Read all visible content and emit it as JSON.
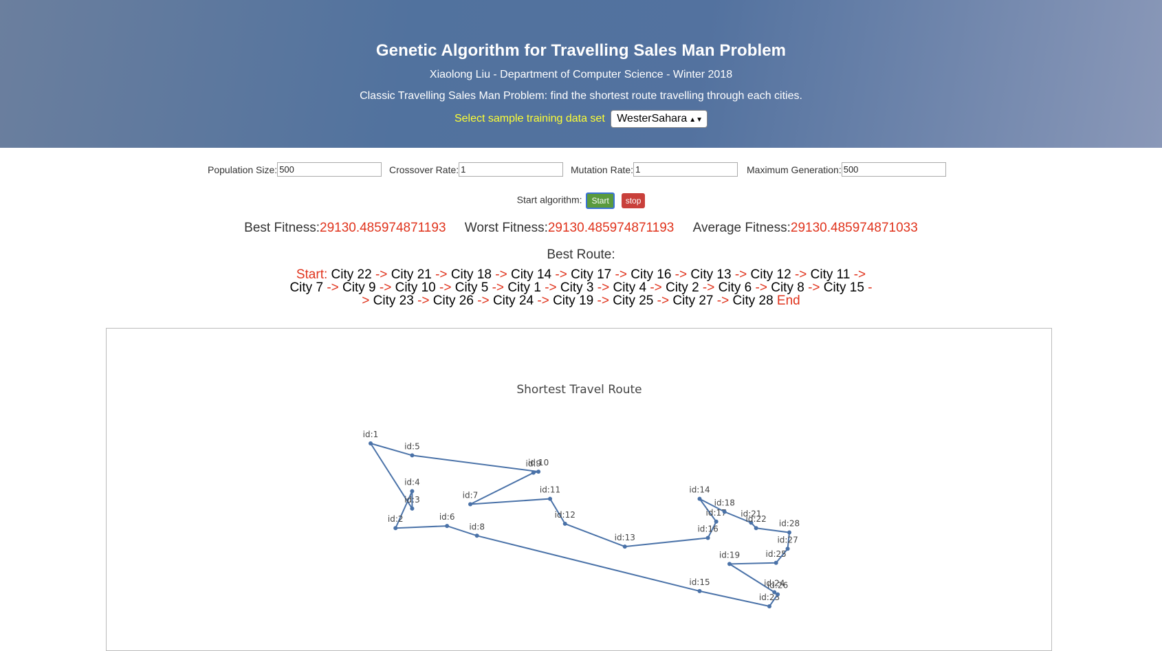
{
  "header": {
    "title": "Genetic Algorithm for Travelling Sales Man Problem",
    "author": "Xiaolong Liu - Department of Computer Science - Winter 2018",
    "description": "Classic Travelling Sales Man Problem: find the shortest route travelling through each cities.",
    "dataset_label": "Select sample training data set",
    "dataset_selected": "WesterSahara"
  },
  "params": {
    "population_label": "Population Size:",
    "population_value": "500",
    "crossover_label": "Crossover Rate:",
    "crossover_value": "1",
    "mutation_label": "Mutation Rate:",
    "mutation_value": "1",
    "maxgen_label": "Maximum Generation:",
    "maxgen_value": "500"
  },
  "controls": {
    "start_label": "Start algorithm:",
    "start_button": "Start",
    "stop_button": "stop"
  },
  "fitness": {
    "best_label": "Best Fitness:",
    "best_value": "29130.485974871193",
    "worst_label": "Worst Fitness:",
    "worst_value": "29130.485974871193",
    "average_label": "Average Fitness:",
    "average_value": "29130.485974871033"
  },
  "route": {
    "title": "Best Route:",
    "start": "Start:",
    "end": "End",
    "arrow": "->",
    "lines": [
      [
        "City 22",
        "City 21",
        "City 18",
        "City 14",
        "City 17",
        "City 16",
        "City 13",
        "City 12",
        "City 11"
      ],
      [
        "City 7",
        "City 9",
        "City 10",
        "City 5",
        "City 1",
        "City 3",
        "City 4",
        "City 2",
        "City 6",
        "City 8",
        "City 15"
      ],
      [
        "City 23",
        "City 26",
        "City 24",
        "City 19",
        "City 25",
        "City 27",
        "City 28"
      ]
    ]
  },
  "chart_data": {
    "type": "line",
    "title": "Shortest Travel Route",
    "line_color": "#4a72a8",
    "points": [
      {
        "id": "id:1",
        "x": 0.5,
        "y": 9.5
      },
      {
        "id": "id:2",
        "x": 2.0,
        "y": 1.7
      },
      {
        "id": "id:3",
        "x": 3.0,
        "y": 3.5
      },
      {
        "id": "id:4",
        "x": 3.0,
        "y": 5.1
      },
      {
        "id": "id:5",
        "x": 3.0,
        "y": 8.4
      },
      {
        "id": "id:6",
        "x": 5.1,
        "y": 1.9
      },
      {
        "id": "id:7",
        "x": 6.5,
        "y": 3.9
      },
      {
        "id": "id:8",
        "x": 6.9,
        "y": 1.0
      },
      {
        "id": "id:9",
        "x": 10.3,
        "y": 6.8
      },
      {
        "id": "id:10",
        "x": 10.6,
        "y": 6.9
      },
      {
        "id": "id:11",
        "x": 11.3,
        "y": 4.4
      },
      {
        "id": "id:12",
        "x": 12.2,
        "y": 2.1
      },
      {
        "id": "id:13",
        "x": 15.8,
        "y": 0.0
      },
      {
        "id": "id:14",
        "x": 20.3,
        "y": 4.4
      },
      {
        "id": "id:15",
        "x": 20.3,
        "y": -4.1
      },
      {
        "id": "id:16",
        "x": 20.8,
        "y": 0.8
      },
      {
        "id": "id:17",
        "x": 21.3,
        "y": 2.3
      },
      {
        "id": "id:18",
        "x": 21.8,
        "y": 3.2
      },
      {
        "id": "id:19",
        "x": 22.1,
        "y": -1.6
      },
      {
        "id": "id:21",
        "x": 23.4,
        "y": 2.2
      },
      {
        "id": "id:22",
        "x": 23.7,
        "y": 1.7
      },
      {
        "id": "id:23",
        "x": 24.5,
        "y": -5.5
      },
      {
        "id": "id:24",
        "x": 24.8,
        "y": -4.2
      },
      {
        "id": "id:25",
        "x": 24.9,
        "y": -1.5
      },
      {
        "id": "id:26",
        "x": 25.0,
        "y": -4.4
      },
      {
        "id": "id:27",
        "x": 25.6,
        "y": -0.2
      },
      {
        "id": "id:28",
        "x": 25.7,
        "y": 1.3
      }
    ],
    "route_order": [
      "id:22",
      "id:21",
      "id:18",
      "id:14",
      "id:17",
      "id:16",
      "id:13",
      "id:12",
      "id:11",
      "id:7",
      "id:9",
      "id:10",
      "id:5",
      "id:1",
      "id:3",
      "id:4",
      "id:2",
      "id:6",
      "id:8",
      "id:15",
      "id:23",
      "id:26",
      "id:24",
      "id:19",
      "id:25",
      "id:27",
      "id:28",
      "id:22"
    ]
  }
}
